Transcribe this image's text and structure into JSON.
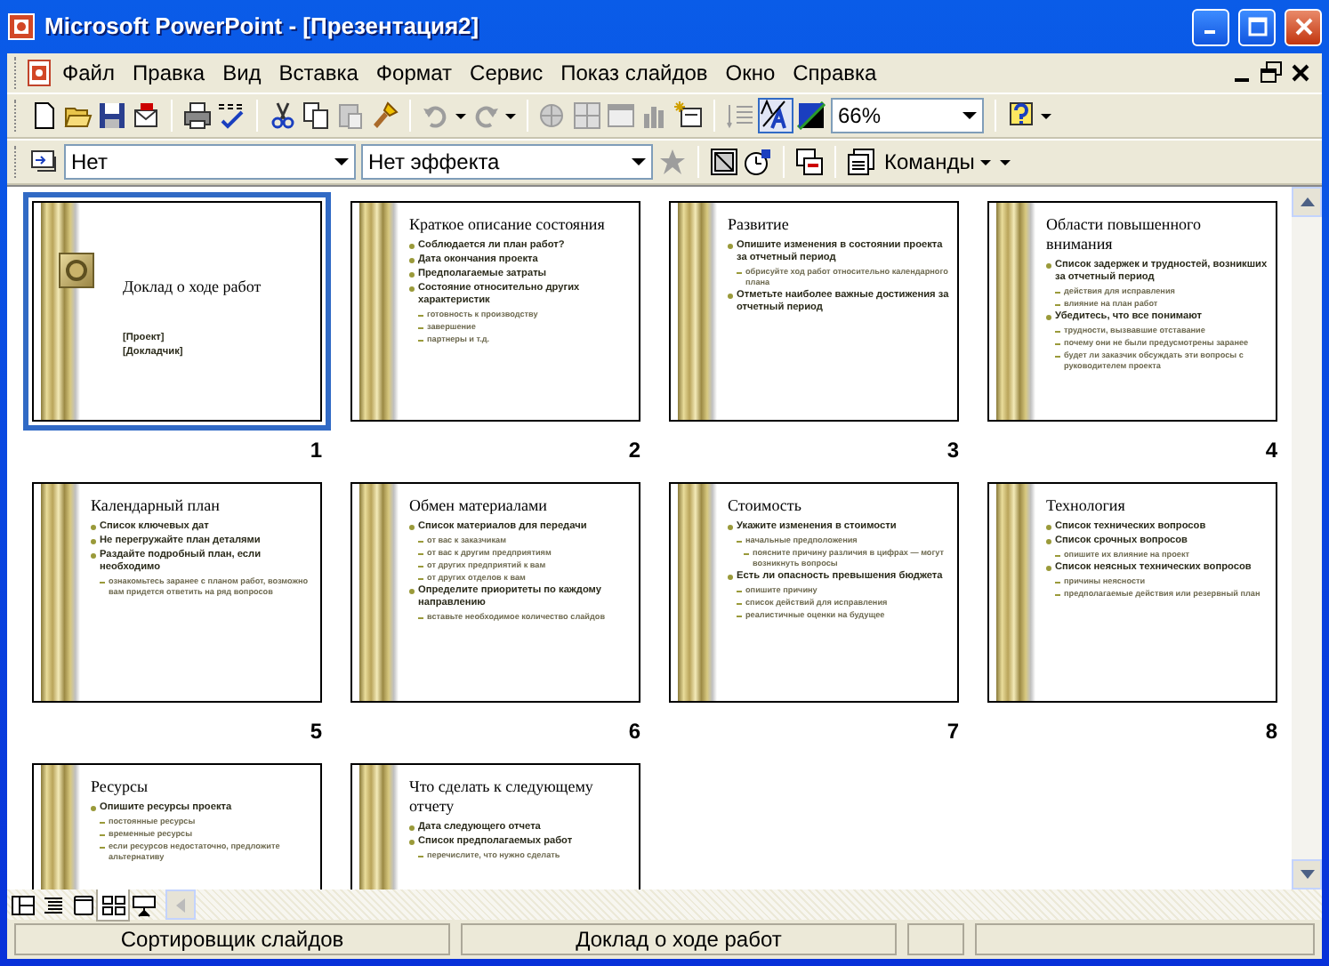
{
  "window": {
    "title": "Microsoft PowerPoint - [Презентация2]"
  },
  "menu": [
    "Файл",
    "Правка",
    "Вид",
    "Вставка",
    "Формат",
    "Сервис",
    "Показ слайдов",
    "Окно",
    "Справка"
  ],
  "standard_toolbar": {
    "zoom": "66%",
    "formatting_shown": true
  },
  "tasks_toolbar": {
    "transition": "Нет",
    "effect": "Нет эффекта",
    "commands": "Команды"
  },
  "slides": [
    {
      "number": "1",
      "selected": true,
      "kind": "title",
      "title": "Доклад о ходе работ",
      "subtitle": [
        "[Проект]",
        "[Докладчик]"
      ]
    },
    {
      "number": "2",
      "selected": false,
      "kind": "bullets",
      "title": "Краткое описание состояния",
      "bullets": [
        {
          "text": "Соблюдается ли план работ?"
        },
        {
          "text": "Дата окончания проекта"
        },
        {
          "text": "Предполагаемые затраты"
        },
        {
          "text": "Состояние относительно других характеристик",
          "children": [
            {
              "text": "готовность к производству"
            },
            {
              "text": "завершение"
            },
            {
              "text": "партнеры и т.д."
            }
          ]
        }
      ]
    },
    {
      "number": "3",
      "selected": false,
      "kind": "bullets",
      "title": "Развитие",
      "bullets": [
        {
          "text": "Опишите изменения в состоянии проекта за отчетный период",
          "children": [
            {
              "text": "обрисуйте ход работ относительно календарного плана"
            }
          ]
        },
        {
          "text": "Отметьте наиболее важные достижения за отчетный период"
        }
      ]
    },
    {
      "number": "4",
      "selected": false,
      "kind": "bullets",
      "title": "Области повышенного внимания",
      "bullets": [
        {
          "text": "Список задержек и трудностей, возникших за отчетный период",
          "children": [
            {
              "text": "действия для исправления"
            },
            {
              "text": "влияние на план работ"
            }
          ]
        },
        {
          "text": "Убедитесь, что все понимают",
          "children": [
            {
              "text": "трудности, вызвавшие отставание"
            },
            {
              "text": "почему они не были предусмотрены заранее"
            },
            {
              "text": "будет ли заказчик обсуждать эти вопросы с руководителем проекта"
            }
          ]
        }
      ]
    },
    {
      "number": "5",
      "selected": false,
      "kind": "bullets",
      "title": "Календарный план",
      "bullets": [
        {
          "text": "Список ключевых дат"
        },
        {
          "text": "Не перегружайте план деталями"
        },
        {
          "text": "Раздайте подробный план, если необходимо",
          "children": [
            {
              "text": "ознакомьтесь заранее с планом работ, возможно вам придется ответить на ряд вопросов"
            }
          ]
        }
      ]
    },
    {
      "number": "6",
      "selected": false,
      "kind": "bullets",
      "title": "Обмен материалами",
      "bullets": [
        {
          "text": "Список материалов для передачи",
          "children": [
            {
              "text": "от вас к заказчикам"
            },
            {
              "text": "от вас к другим предприятиям"
            },
            {
              "text": "от других предприятий к вам"
            },
            {
              "text": "от других отделов к вам"
            }
          ]
        },
        {
          "text": "Определите приоритеты по каждому направлению",
          "children": [
            {
              "text": "вставьте необходимое количество слайдов"
            }
          ]
        }
      ]
    },
    {
      "number": "7",
      "selected": false,
      "kind": "bullets",
      "title": "Стоимость",
      "bullets": [
        {
          "text": "Укажите изменения в стоимости",
          "children": [
            {
              "text": "начальные предположения",
              "children": [
                {
                  "text": "поясните причину различия в цифрах — могут возникнуть вопросы"
                }
              ]
            }
          ]
        },
        {
          "text": "Есть ли опасность превышения бюджета",
          "children": [
            {
              "text": "опишите причину"
            },
            {
              "text": "список действий для исправления"
            },
            {
              "text": "реалистичные оценки на будущее"
            }
          ]
        }
      ]
    },
    {
      "number": "8",
      "selected": false,
      "kind": "bullets",
      "title": "Технология",
      "bullets": [
        {
          "text": "Список технических вопросов"
        },
        {
          "text": "Список срочных вопросов",
          "children": [
            {
              "text": "опишите их влияние на проект"
            }
          ]
        },
        {
          "text": "Список неясных технических вопросов",
          "children": [
            {
              "text": "причины неясности"
            },
            {
              "text": "предполагаемые действия или резервный план"
            }
          ]
        }
      ]
    },
    {
      "selected": false,
      "kind": "bullets",
      "title": "Ресурсы",
      "bullets": [
        {
          "text": "Опишите ресурсы проекта",
          "children": [
            {
              "text": "постоянные ресурсы"
            },
            {
              "text": "временные ресурсы"
            },
            {
              "text": "если ресурсов недостаточно, предложите альтернативу"
            }
          ]
        }
      ]
    },
    {
      "selected": false,
      "kind": "bullets",
      "title": "Что сделать к следующему отчету",
      "bullets": [
        {
          "text": "Дата следующего отчета"
        },
        {
          "text": "Список предполагаемых работ",
          "children": [
            {
              "text": "перечислите, что нужно сделать"
            }
          ]
        }
      ]
    }
  ],
  "view_buttons": [
    {
      "selected": false
    },
    {
      "selected": false
    },
    {
      "selected": false
    },
    {
      "selected": true
    },
    {
      "selected": false
    }
  ],
  "status_bar": [
    "Сортировщик слайдов",
    "Доклад о ходе работ"
  ]
}
